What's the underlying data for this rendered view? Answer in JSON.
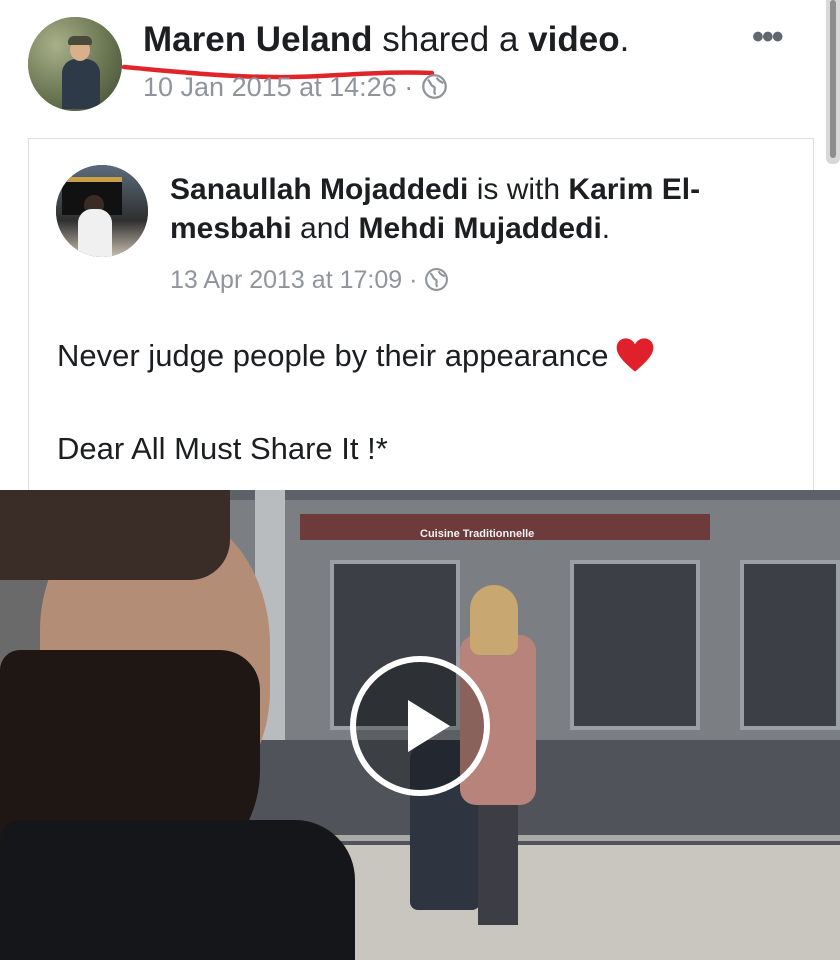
{
  "outer_post": {
    "author": "Maren Ueland",
    "action_prefix": " shared a ",
    "action_object": "video",
    "action_suffix": ".",
    "timestamp": "10 Jan 2015 at 14:26",
    "separator": " · ",
    "privacy_icon": "globe-icon",
    "more_icon": "more-options-icon",
    "more_label": "•••",
    "underline_color": "#e0252a"
  },
  "shared_post": {
    "author": "Sanaullah Mojaddedi",
    "with_text": " is with ",
    "tagged_1": "Karim El-mesbahi",
    "and_text": " and ",
    "tagged_2": "Mehdi Mujaddedi",
    "end": ".",
    "timestamp": "13 Apr 2013 at 17:09",
    "separator": " · ",
    "privacy_icon": "globe-icon",
    "text_line_1": "Never judge people by their appearance",
    "emoji": "heart-icon",
    "text_line_2": "Dear All Must Share It !*",
    "heart_color": "#e0202b"
  },
  "video": {
    "sign_text": "Cuisine Traditionnelle",
    "play_icon": "play-icon"
  },
  "colors": {
    "text": "#1c1e21",
    "meta": "#90949c",
    "border": "#dddfe2"
  }
}
